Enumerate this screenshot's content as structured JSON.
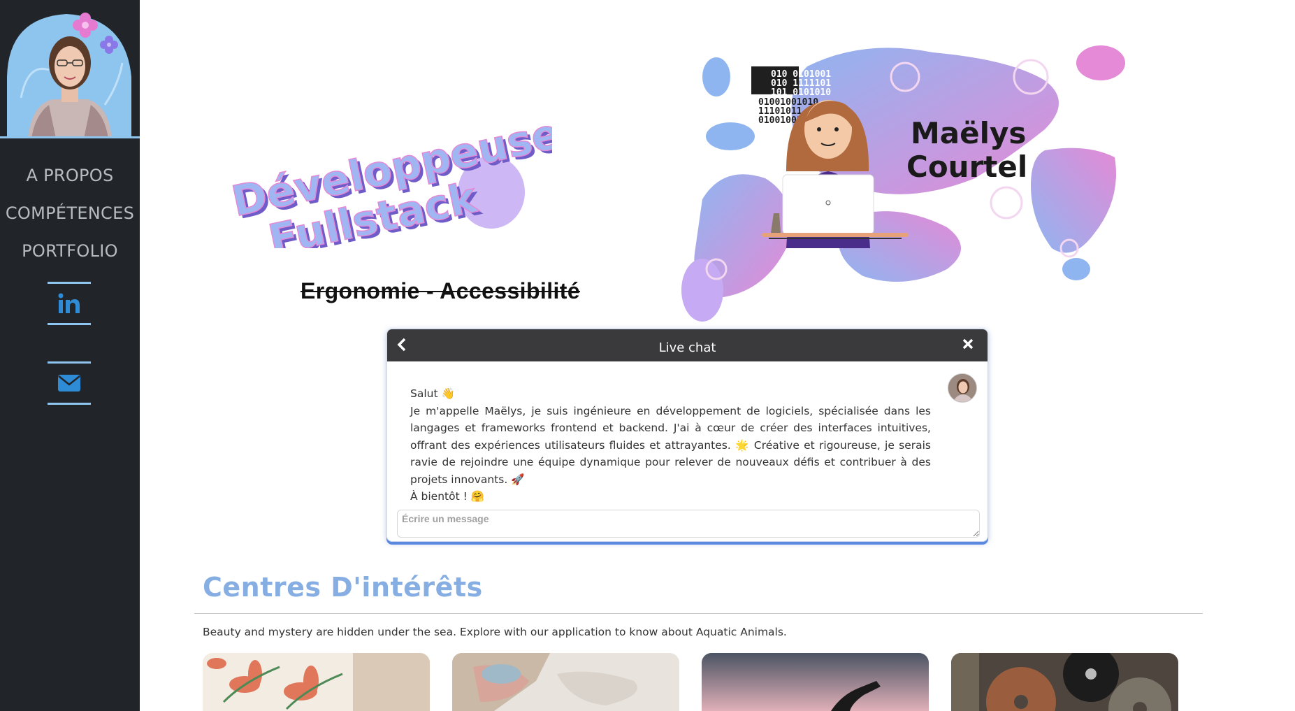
{
  "sidebar": {
    "nav": [
      "A PROPOS",
      "COMPÉTENCES",
      "PORTFOLIO"
    ],
    "social": [
      {
        "name": "linkedin-icon"
      },
      {
        "name": "envelope-icon"
      }
    ]
  },
  "hero": {
    "title_line1": "Développeuse",
    "title_line2": "Fullstack",
    "subtitle": "Ergonomie - Accessibilité",
    "name_line1": "Maëlys",
    "name_line2": "Courtel",
    "binary_lines": [
      "010 0101001",
      "010 1111101",
      "101 0101010",
      "01001001010",
      "11101011",
      "01001001"
    ]
  },
  "chat": {
    "title": "Live chat",
    "back_icon": "chevron-left-icon",
    "close_icon": "close-icon",
    "greeting": "Salut 👋",
    "body": "Je m'appelle Maëlys, je suis ingénieure en développement de logiciels, spécialisée dans les langages et frameworks frontend et backend. J'ai à cœur de créer des interfaces intuitives, offrant des expériences utilisateurs fluides et attrayantes. 🌟  Créative et rigoureuse, je serais ravie de rejoindre une équipe dynamique pour relever de nouveaux défis et contribuer à des projets innovants. 🚀",
    "signoff": "À bientôt ! 🤗",
    "input_placeholder": "Écrire un message"
  },
  "interests": {
    "title": "Centres D'intérêts",
    "description": "Beauty and mystery are hidden under the sea. Explore with our application to know about Aquatic Animals.",
    "cards": [
      {
        "name": "floral-painting"
      },
      {
        "name": "world-map"
      },
      {
        "name": "sunset-silhouette"
      },
      {
        "name": "film-reels"
      }
    ]
  },
  "colors": {
    "sidebar_bg": "#212529",
    "accent_blue": "#86aee3",
    "link_blue": "#2e8bd6",
    "chat_header": "#3a3a3c",
    "blob_pink": "#e48ad6",
    "blob_blue": "#8fb5f0"
  }
}
